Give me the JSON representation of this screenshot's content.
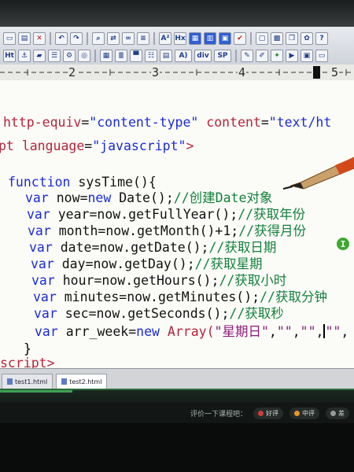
{
  "ruler": {
    "numbers": [
      "2",
      "3",
      "4",
      "5"
    ]
  },
  "toolbar": {
    "row1": [
      "A²",
      "Hx"
    ],
    "row2": [
      "Ht",
      "A)",
      "div",
      "SP"
    ]
  },
  "code": {
    "line1": {
      "indent": "",
      "attr1": "http-equiv",
      "eq1": "=",
      "val1": "\"content-type\"",
      "attr2": " content",
      "eq2": "=",
      "val2": "\"text/ht"
    },
    "line2": {
      "prefix": "pt ",
      "attr": "language",
      "eq": "=",
      "val": "\"javascript\"",
      "close": ">"
    },
    "func_kw": "function",
    "func_name": " sysTime(){",
    "vars": [
      {
        "kw": "var",
        "name": " now",
        "eq": "=",
        "rhs_kw": "new",
        "rhs": " Date();",
        "comment": "//创建Date对象"
      },
      {
        "kw": "var",
        "name": " year",
        "eq": "=",
        "rhs_kw": "",
        "rhs": "now.getFullYear();",
        "comment": "//获取年份"
      },
      {
        "kw": "var",
        "name": " month",
        "eq": "=",
        "rhs_kw": "",
        "rhs": "now.getMonth()+1;",
        "comment": "//获得月份"
      },
      {
        "kw": "var",
        "name": " date",
        "eq": "=",
        "rhs_kw": "",
        "rhs": "now.getDate();",
        "comment": "//获取日期"
      },
      {
        "kw": "var",
        "name": " day",
        "eq": "=",
        "rhs_kw": "",
        "rhs": "now.getDay();",
        "comment": "//获取星期"
      },
      {
        "kw": "var",
        "name": " hour",
        "eq": "=",
        "rhs_kw": "",
        "rhs": "now.getHours();",
        "comment": "//获取小时"
      },
      {
        "kw": "var",
        "name": " minutes",
        "eq": "=",
        "rhs_kw": "",
        "rhs": "now.getMinutes();",
        "comment": "//获取分钟"
      },
      {
        "kw": "var",
        "name": " sec",
        "eq": "=",
        "rhs_kw": "",
        "rhs": "now.getSeconds();",
        "comment": "//获取秒"
      }
    ],
    "arr_line": {
      "kw": "var",
      "name": " arr_week",
      "eq": "=",
      "new_kw": "new",
      "ctor": " Array(",
      "s1": "\"星期日\"",
      "c1": ",",
      "s2": "\"\"",
      "c2": ",",
      "s3": "\"\"",
      "c3": ",",
      "s4": "\"\"",
      "c4": ","
    },
    "close_brace": "}",
    "script_close": "script>"
  },
  "tabs": [
    {
      "label": "test1.html",
      "active": false
    },
    {
      "label": "test2.html",
      "active": true
    }
  ],
  "player": {
    "rating_prompt": "评价一下课程吧：",
    "good": "好评",
    "medium": "中评",
    "bad": "差"
  },
  "colors": {
    "keyword": "#1a2bd6",
    "attribute": "#b3263b",
    "comment": "#15803d",
    "string": "#8b1c7a"
  }
}
